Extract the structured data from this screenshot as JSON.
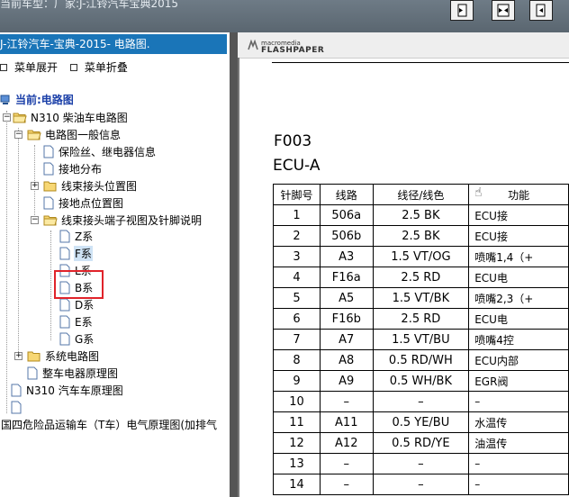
{
  "topbar": {
    "title": "当前车型：厂家:J-江铃汽车宝典2015"
  },
  "toolbar": {
    "buttons": [
      {
        "name": "fit-page-button",
        "icon": "fit-page-icon"
      },
      {
        "name": "fit-width-button",
        "icon": "fit-width-icon"
      },
      {
        "name": "actual-size-button",
        "icon": "actual-size-icon"
      }
    ]
  },
  "left": {
    "header": "J-江铃汽车-宝典-2015- 电路图.",
    "expand_all": "菜单展开",
    "collapse_all": "菜单折叠",
    "tree": {
      "current": "当前:电路图",
      "n310_diesel": "N310 柴油车电路图",
      "general_info": "电路图一般信息",
      "fuse_relay": "保险丝、继电器信息",
      "ground_dist": "接地分布",
      "harness_connector_loc": "线束接头位置图",
      "ground_point_loc": "接地点位置图",
      "harness_terminal_view": "线束接头端子视图及针脚说明",
      "series": [
        "Z系",
        "F系",
        "L系",
        "B系",
        "D系",
        "E系",
        "G系"
      ],
      "system_diagrams": "系统电路图",
      "vehicle_schematic": "整车电器原理图",
      "n310_vehicle": "N310 汽车车原理图",
      "hazmat": "国四危险品运输车（T车）电气原理图(加排气"
    }
  },
  "viewer": {
    "logo_top": "macromedia",
    "logo_bottom": "FLASHPAPER",
    "code": "F003",
    "ecu": "ECU-A",
    "headers": [
      "针脚号",
      "线路",
      "线径/线色",
      "功能"
    ],
    "rows": [
      [
        "1",
        "506a",
        "2.5 BK",
        "ECU接"
      ],
      [
        "2",
        "506b",
        "2.5 BK",
        "ECU接"
      ],
      [
        "3",
        "A3",
        "1.5 VT/OG",
        "喷嘴1,4（+"
      ],
      [
        "4",
        "F16a",
        "2.5 RD",
        "ECU电"
      ],
      [
        "5",
        "A5",
        "1.5 VT/BK",
        "喷嘴2,3（+"
      ],
      [
        "6",
        "F16b",
        "2.5 RD",
        "ECU电"
      ],
      [
        "7",
        "A7",
        "1.5 VT/BU",
        "喷嘴4控"
      ],
      [
        "8",
        "A8",
        "0.5 RD/WH",
        "ECU内部"
      ],
      [
        "9",
        "A9",
        "0.5 WH/BK",
        "EGR阀"
      ],
      [
        "10",
        "–",
        "–",
        "–"
      ],
      [
        "11",
        "A11",
        "0.5 YE/BU",
        "水温传"
      ],
      [
        "12",
        "A12",
        "0.5 RD/YE",
        "油温传"
      ],
      [
        "13",
        "–",
        "–",
        "–"
      ],
      [
        "14",
        "–",
        "–",
        "–"
      ]
    ]
  }
}
